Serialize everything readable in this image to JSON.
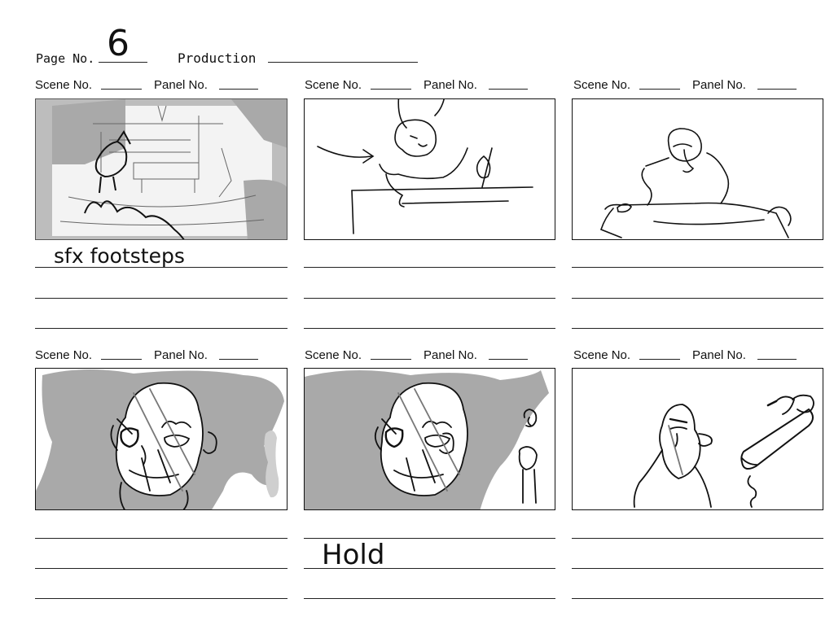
{
  "header": {
    "page_label": "Page No.",
    "page_value": "6",
    "production_label": "Production",
    "production_value": ""
  },
  "panels": [
    {
      "scene_label": "Scene No.",
      "panel_label": "Panel No.",
      "note_1": "sfx footsteps",
      "note_2": "",
      "note_3": ""
    },
    {
      "scene_label": "Scene No.",
      "panel_label": "Panel No.",
      "note_1": "",
      "note_2": "",
      "note_3": ""
    },
    {
      "scene_label": "Scene No.",
      "panel_label": "Panel No.",
      "note_1": "",
      "note_2": "",
      "note_3": ""
    },
    {
      "scene_label": "Scene No.",
      "panel_label": "Panel No.",
      "note_1": "",
      "note_2": "",
      "note_3": ""
    },
    {
      "scene_label": "Scene No.",
      "panel_label": "Panel No.",
      "note_1": "Hold",
      "note_2": "",
      "note_3": ""
    },
    {
      "scene_label": "Scene No.",
      "panel_label": "Panel No.",
      "note_1": "",
      "note_2": "",
      "note_3": ""
    }
  ],
  "colors": {
    "ink": "#111111",
    "tone": "#a9a9a9",
    "paper": "#ffffff"
  }
}
